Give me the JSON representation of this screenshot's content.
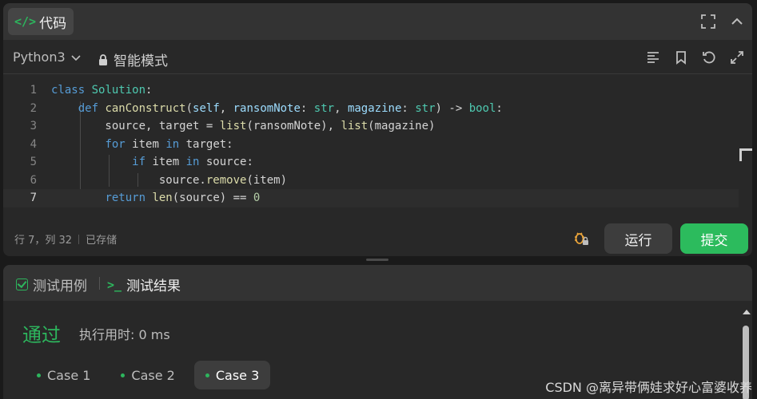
{
  "header": {
    "code_tab_label": "代码",
    "code_tab_icon": "code-icon"
  },
  "toolbar": {
    "language": "Python3",
    "mode": "智能模式"
  },
  "editor": {
    "lines": [
      {
        "num": "1",
        "text": "class Solution:"
      },
      {
        "num": "2",
        "text": "    def canConstruct(self, ransomNote: str, magazine: str) -> bool:"
      },
      {
        "num": "3",
        "text": "        source, target = list(ransomNote), list(magazine)"
      },
      {
        "num": "4",
        "text": "        for item in target:"
      },
      {
        "num": "5",
        "text": "            if item in source:"
      },
      {
        "num": "6",
        "text": "                source.remove(item)"
      },
      {
        "num": "7",
        "text": "        return len(source) == 0"
      }
    ],
    "active_line": "7"
  },
  "status": {
    "position": "行 7，列 32",
    "saved": "已存储"
  },
  "actions": {
    "run": "运行",
    "submit": "提交"
  },
  "bottom": {
    "tab_testcases": "测试用例",
    "tab_results": "测试结果",
    "result_status": "通过",
    "runtime": "执行用时: 0 ms",
    "cases": [
      "Case 1",
      "Case 2",
      "Case 3"
    ],
    "selected_case": "Case 3"
  },
  "watermark": "CSDN @离异带俩娃求好心富婆收养",
  "colors": {
    "accent_green": "#2db55d",
    "background": "#282828",
    "header": "#333333"
  }
}
